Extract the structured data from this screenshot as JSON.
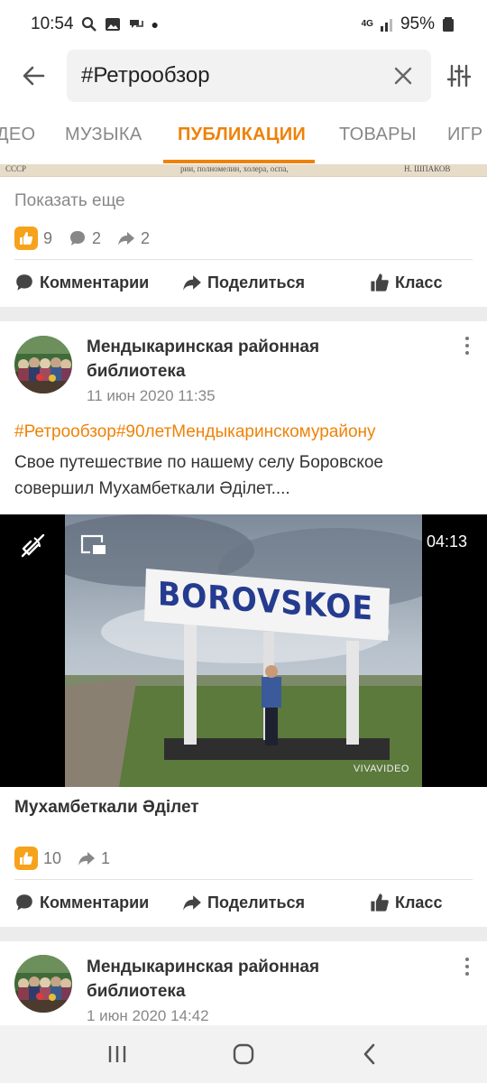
{
  "status": {
    "time": "10:54",
    "network": "4G",
    "battery": "95%"
  },
  "search": {
    "query": "#Ретрообзор"
  },
  "tabs": [
    {
      "label": "ДЕО"
    },
    {
      "label": "МУЗЫКА"
    },
    {
      "label": "ПУБЛИКАЦИИ",
      "active": true
    },
    {
      "label": "ТОВАРЫ"
    },
    {
      "label": "ИГР"
    }
  ],
  "clipping": {
    "left": "СССР",
    "mid": "рии, полномелин, холера, оспа,",
    "right": "Н. ШПАКОВ"
  },
  "post1": {
    "show_more": "Показать еще",
    "likes": "9",
    "comments": "2",
    "shares": "2",
    "actions": {
      "comment": "Комментарии",
      "share": "Поделиться",
      "like": "Класс"
    }
  },
  "post2": {
    "author_line1": "Мендыкаринская районная",
    "author_line2": "библиотека",
    "date": "11 июн 2020 11:35",
    "hashtags": "#Ретрообзор#90летМендыкаринскомурайону",
    "text_line1": "Свое путешествие по нашему селу Боровское",
    "text_line2": "совершил Мухамбеткали Әділет....",
    "video": {
      "duration": "04:13",
      "sign": "BOROVSKOE",
      "watermark": "VIVAVIDEO"
    },
    "video_title": "Мухамбеткали Әділет",
    "likes": "10",
    "shares": "1",
    "actions": {
      "comment": "Комментарии",
      "share": "Поделиться",
      "like": "Класс"
    }
  },
  "post3": {
    "author_line1": "Мендыкаринская районная",
    "author_line2": "библиотека",
    "date": "1 июн 2020 14:42"
  },
  "colors": {
    "accent": "#ee8208",
    "like_badge": "#f7a21b"
  }
}
